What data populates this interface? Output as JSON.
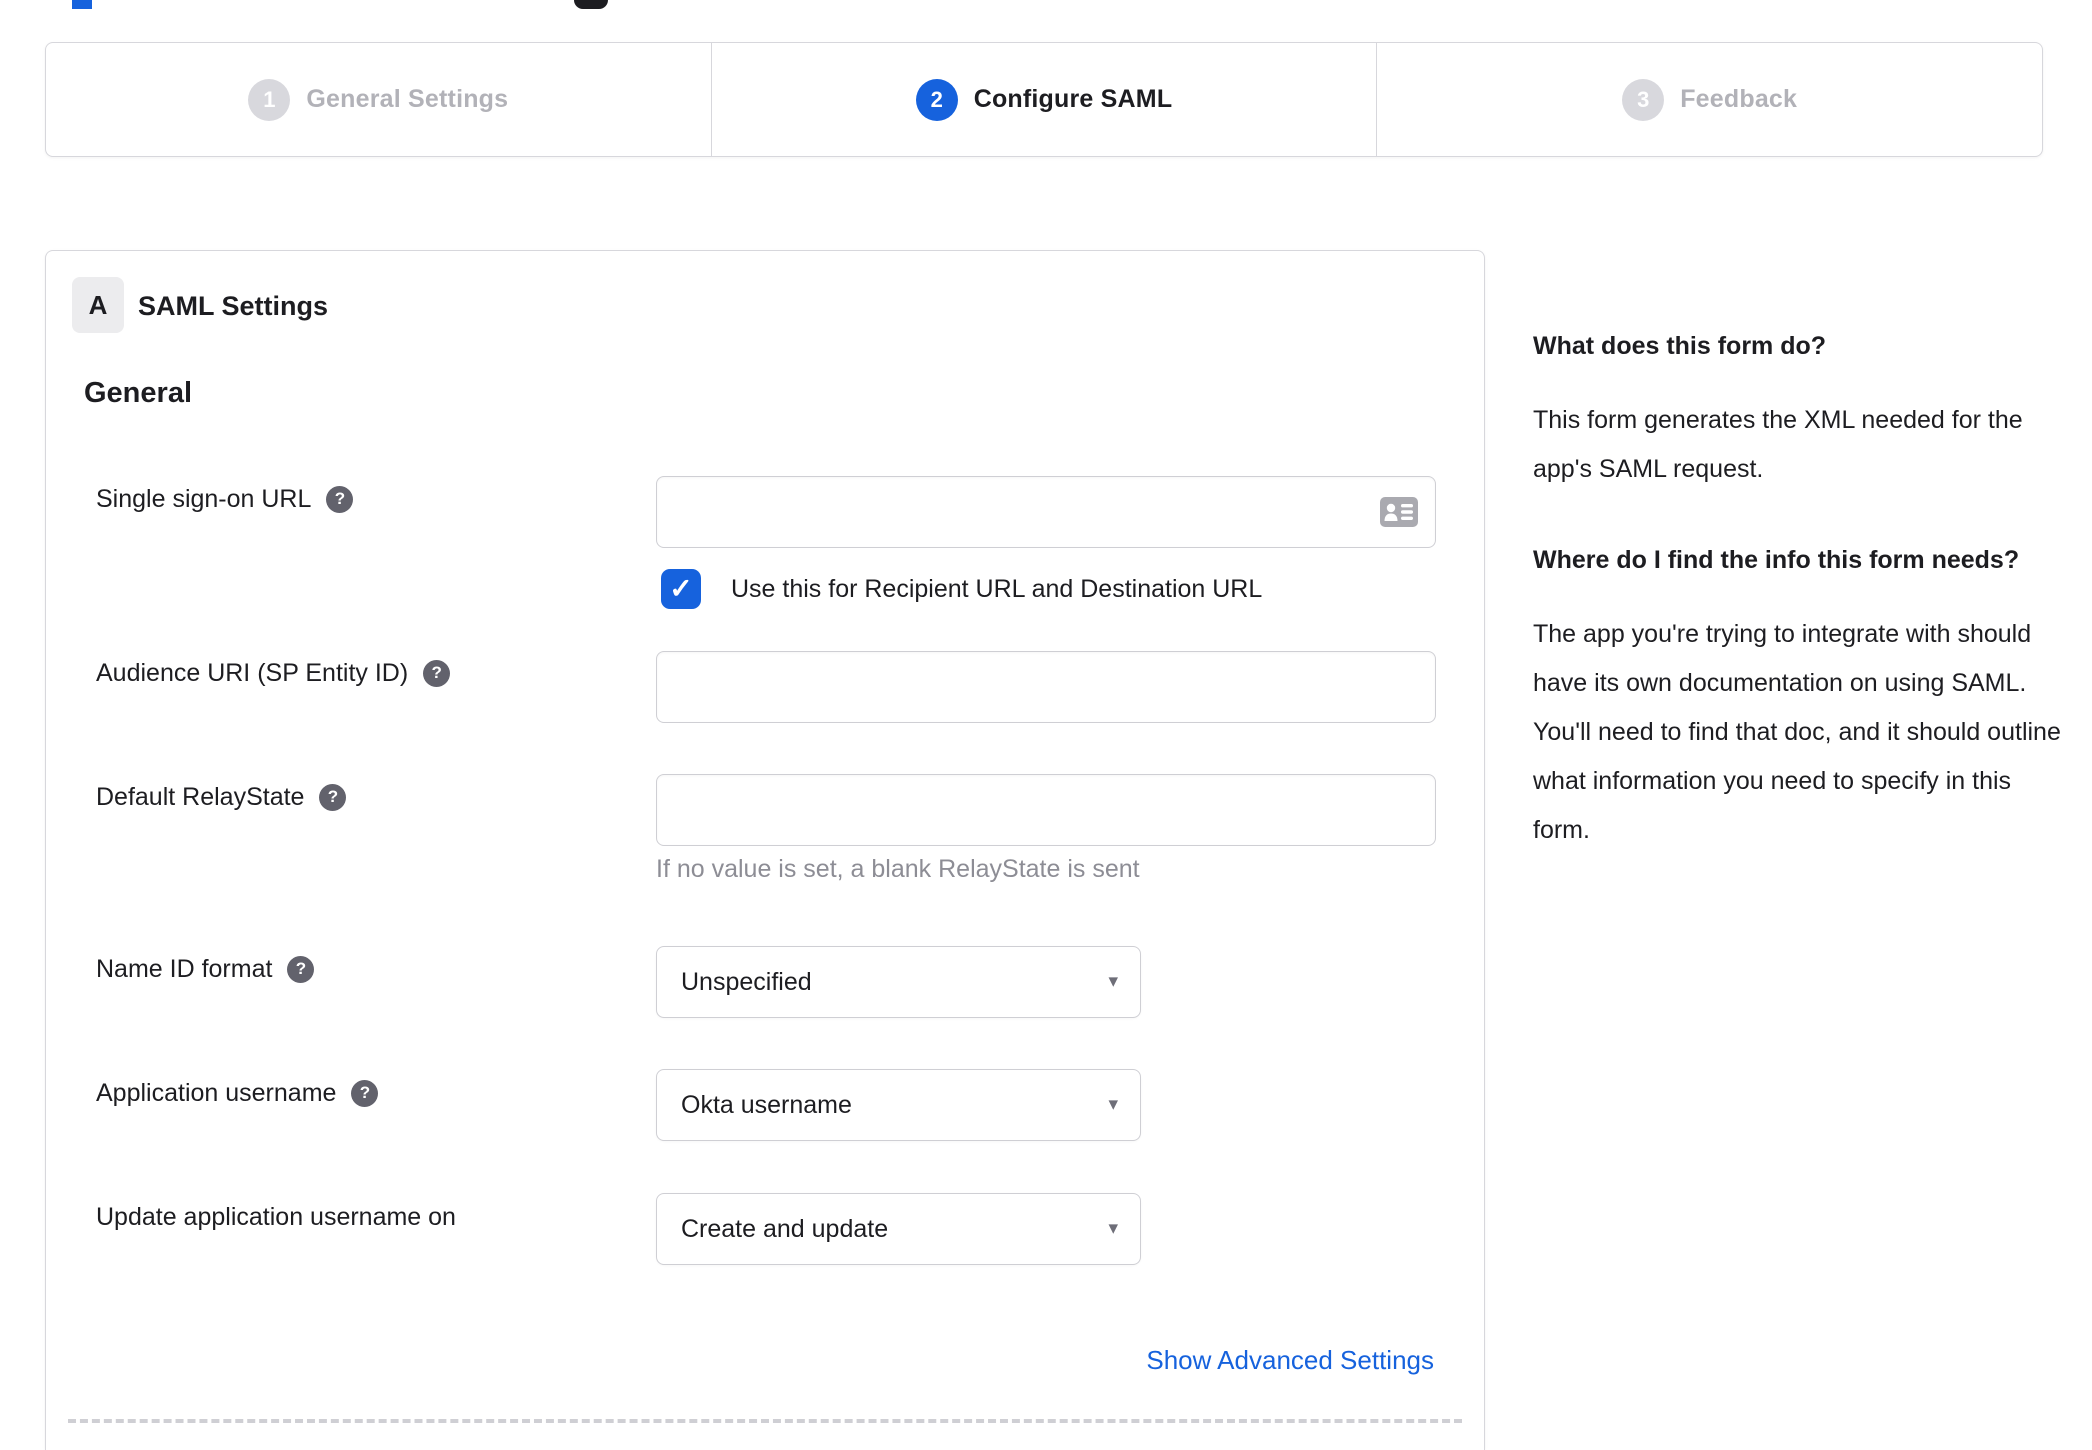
{
  "colors": {
    "accent_blue": "#1662dd",
    "link_blue": "#1662dd",
    "text_dark": "#1d1d21",
    "inactive_gray": "#b2b2b8",
    "border_gray": "#d7d7dc",
    "hint_gray": "#8d8d95"
  },
  "icons": {
    "help": "?",
    "dropdown_caret": "▾",
    "checkbox_check": "✓"
  },
  "stepper": {
    "steps": [
      {
        "number": "1",
        "label": "General Settings",
        "state": "inactive"
      },
      {
        "number": "2",
        "label": "Configure SAML",
        "state": "active"
      },
      {
        "number": "3",
        "label": "Feedback",
        "state": "inactive"
      }
    ]
  },
  "panel": {
    "badge": "A",
    "title": "SAML Settings",
    "section_heading": "General",
    "fields": {
      "sso_url": {
        "label": "Single sign-on URL",
        "value": "",
        "checkbox_label": "Use this for Recipient URL and Destination URL",
        "checkbox_checked": true
      },
      "audience_uri": {
        "label": "Audience URI (SP Entity ID)",
        "value": ""
      },
      "relay_state": {
        "label": "Default RelayState",
        "value": "",
        "hint": "If no value is set, a blank RelayState is sent"
      },
      "name_id_format": {
        "label": "Name ID format",
        "value": "Unspecified"
      },
      "app_username": {
        "label": "Application username",
        "value": "Okta username"
      },
      "update_username": {
        "label": "Update application username on",
        "value": "Create and update"
      }
    },
    "advanced_link": "Show Advanced Settings"
  },
  "sidebar": {
    "heading1": "What does this form do?",
    "body1": "This form generates the XML needed for the app's SAML request.",
    "heading2": "Where do I find the info this form needs?",
    "body2": "The app you're trying to integrate with should have its own documentation on using SAML. You'll need to find that doc, and it should outline what information you need to specify in this form."
  }
}
